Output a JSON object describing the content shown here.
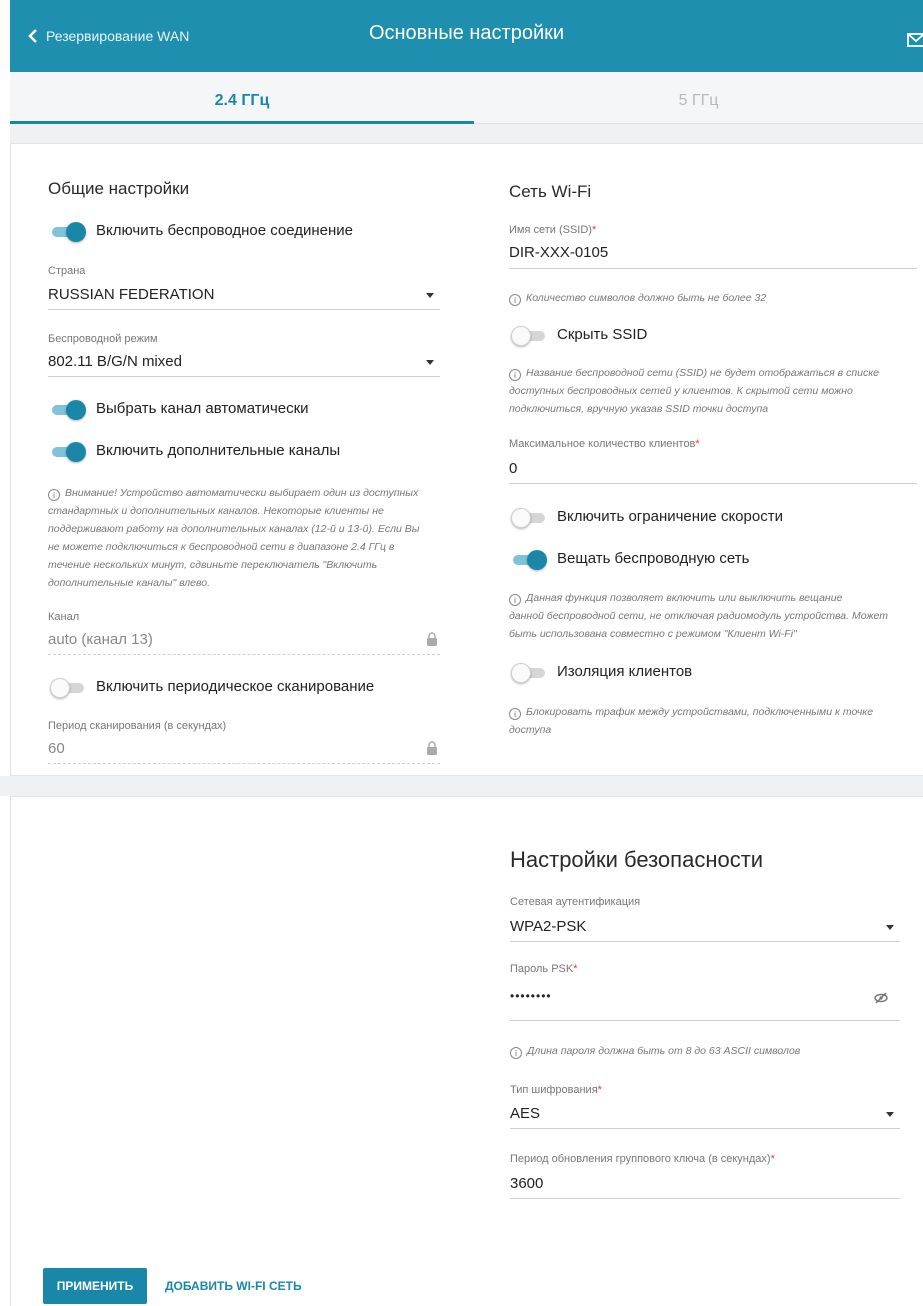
{
  "header": {
    "back_label": "Резервирование WAN",
    "title": "Основные настройки"
  },
  "tabs": [
    {
      "label": "2.4 ГГц",
      "active": true
    },
    {
      "label": "5 ГГц",
      "active": false
    }
  ],
  "general": {
    "title": "Общие настройки",
    "enable_wireless": {
      "label": "Включить беспроводное соединение",
      "on": true
    },
    "country": {
      "label": "Страна",
      "value": "RUSSIAN FEDERATION"
    },
    "mode": {
      "label": "Беспроводной режим",
      "value": "802.11 B/G/N mixed"
    },
    "auto_channel": {
      "label": "Выбрать канал автоматически",
      "on": true
    },
    "extra_channels": {
      "label": "Включить дополнительные каналы",
      "on": true
    },
    "warning_lines": [
      "Внимание! Устройство автоматически выбирает один из доступных",
      "стандартных и дополнительных каналов. Некоторые клиенты не",
      "поддерживают работу на дополнительных каналах (12-й и 13-й). Если Вы",
      "не можете подключиться к беспроводной сети в диапазоне 2.4 ГГц в",
      "течение нескольких минут, сдвиньте переключатель \"Включить",
      "дополнительные каналы\" влево."
    ],
    "channel": {
      "label": "Канал",
      "value": "auto (канал 13)"
    },
    "periodic_scan": {
      "label": "Включить периодическое сканирование",
      "on": false
    },
    "scan_period": {
      "label": "Период сканирования (в секундах)",
      "value": "60"
    }
  },
  "wifi": {
    "title": "Сеть Wi-Fi",
    "ssid": {
      "label": "Имя сети (SSID)",
      "value": "DIR-XXX-0105"
    },
    "ssid_hint": "Количество символов должно быть не более 32",
    "hide_ssid": {
      "label": "Скрыть SSID",
      "on": false
    },
    "hide_hint_lines": [
      "Название беспроводной сети (SSID) не будет отображаться в списке",
      "доступных беспроводных сетей у клиентов. К скрытой сети можно",
      "подключиться, вручную указав SSID точки доступа"
    ],
    "max_clients": {
      "label": "Максимальное количество клиентов",
      "value": "0"
    },
    "rate_limit": {
      "label": "Включить ограничение скорости",
      "on": false
    },
    "broadcast": {
      "label": "Вещать беспроводную сеть",
      "on": true
    },
    "broadcast_hint_lines": [
      "Данная функция позволяет включить или выключить вещание",
      "данной беспроводной сети, не отключая радиомодуль устройства. Может",
      "быть использована совместно с режимом \"Клиент Wi-Fi\""
    ],
    "isolation": {
      "label": "Изоляция клиентов",
      "on": false
    },
    "isolation_hint_lines": [
      "Блокировать трафик между устройствами, подключенными к точке",
      "доступа"
    ]
  },
  "security": {
    "title": "Настройки безопасности",
    "auth": {
      "label": "Сетевая аутентификация",
      "value": "WPA2-PSK"
    },
    "psk": {
      "label": "Пароль PSK",
      "value": "••••••••"
    },
    "psk_hint": "Длина пароля должна быть от 8 до 63 ASCII символов",
    "cipher": {
      "label": "Тип шифрования",
      "value": "AES"
    },
    "rekey": {
      "label": "Период обновления группового ключа (в секундах)",
      "value": "3600"
    }
  },
  "actions": {
    "apply": "ПРИМЕНИТЬ",
    "add_wifi": "ДОБАВИТЬ WI-FI СЕТЬ"
  },
  "colors": {
    "accent": "#1a87a9",
    "header_bg": "#1f8fb0",
    "required": "#e03b3b"
  }
}
